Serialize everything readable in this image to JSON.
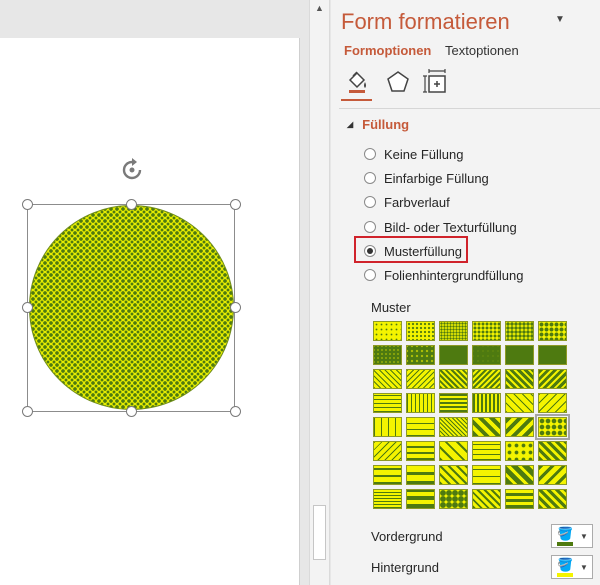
{
  "pane": {
    "title": "Form formatieren",
    "tabs": [
      {
        "label": "Formoptionen",
        "active": true
      },
      {
        "label": "Textoptionen",
        "active": false
      }
    ],
    "categories": [
      {
        "icon": "fill-line-icon",
        "active": true
      },
      {
        "icon": "effects-pentagon-icon",
        "active": false
      },
      {
        "icon": "size-properties-icon",
        "active": false
      }
    ],
    "fill_section": {
      "title": "Füllung",
      "options": [
        {
          "label": "Keine Füllung",
          "selected": false
        },
        {
          "label": "Einfarbige Füllung",
          "selected": false
        },
        {
          "label": "Farbverlauf",
          "selected": false
        },
        {
          "label": "Bild- oder Texturfüllung",
          "selected": false
        },
        {
          "label": "Musterfüllung",
          "selected": true
        },
        {
          "label": "Folienhintergrundfüllung",
          "selected": false
        }
      ],
      "pattern_label": "Muster",
      "pattern_count": 48,
      "selected_pattern": 29,
      "foreground_label": "Vordergrund",
      "background_label": "Hintergrund"
    }
  },
  "colors": {
    "accent": "#c55a3a",
    "highlight_box": "#d0232b",
    "pattern_foreground": "#4e7a10",
    "pattern_background": "#f4f400"
  }
}
